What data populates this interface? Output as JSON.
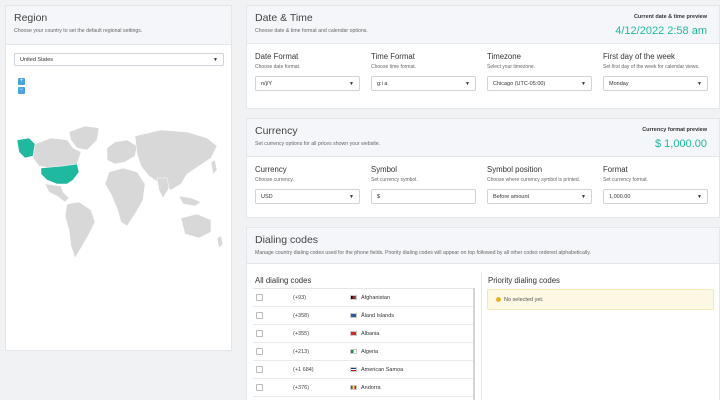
{
  "region": {
    "title": "Region",
    "description": "Choose your country to set the default regional settings.",
    "country": "United States",
    "zoom_in": "+",
    "zoom_out": "−"
  },
  "datetime": {
    "title": "Date & Time",
    "description": "Choose date & time format and calendar options.",
    "preview_label": "Current date & time preview",
    "preview_value": "4/12/2022  2:58 am",
    "fields": [
      {
        "label": "Date Format",
        "desc": "Choose date format.",
        "value": "n/j/Y"
      },
      {
        "label": "Time Format",
        "desc": "Choose time format.",
        "value": "g:i a"
      },
      {
        "label": "Timezone",
        "desc": "Select your timezone.",
        "value": "Chicago (UTC-05:00)"
      },
      {
        "label": "First day of the week",
        "desc": "Set first day of the week for calendar views.",
        "value": "Monday"
      }
    ]
  },
  "currency": {
    "title": "Currency",
    "description": "Set currency options for all prices shown your website.",
    "preview_label": "Currency format preview",
    "preview_value": "$ 1,000.00",
    "fields": [
      {
        "label": "Currency",
        "desc": "Choose currency.",
        "value": "USD"
      },
      {
        "label": "Symbol",
        "desc": "Set currency symbol.",
        "value": "$"
      },
      {
        "label": "Symbol position",
        "desc": "Choose where currency symbol is printed.",
        "value": "Before amount"
      },
      {
        "label": "Format",
        "desc": "Set currency format.",
        "value": "1,000.00"
      }
    ]
  },
  "dialing": {
    "title": "Dialing codes",
    "description": "Manage country dialing codes used for the phone fields. Priority dialing codes will appear on top followed by all other codes ordered alphabetically.",
    "all_title": "All dialing codes",
    "priority_title": "Priority dialing codes",
    "empty_notice": "No selected yet.",
    "rows": [
      {
        "code": "(+93)",
        "country": "Afghanistan",
        "flag": "#3a7d44"
      },
      {
        "code": "(+358)",
        "country": "Åland Islands",
        "flag": "#2b5aa8"
      },
      {
        "code": "(+355)",
        "country": "Albania",
        "flag": "#d7261e"
      },
      {
        "code": "(+213)",
        "country": "Algeria",
        "flag": "#1e8c46"
      },
      {
        "code": "(+1 684)",
        "country": "American Samoa",
        "flag": "#1f3a8a"
      },
      {
        "code": "(+376)",
        "country": "Andorra",
        "flag": "#2f4fa1"
      }
    ]
  },
  "colors": {
    "accent": "#1fb99f",
    "map_land": "#d8d8d8",
    "map_selected": "#1fb99f"
  }
}
